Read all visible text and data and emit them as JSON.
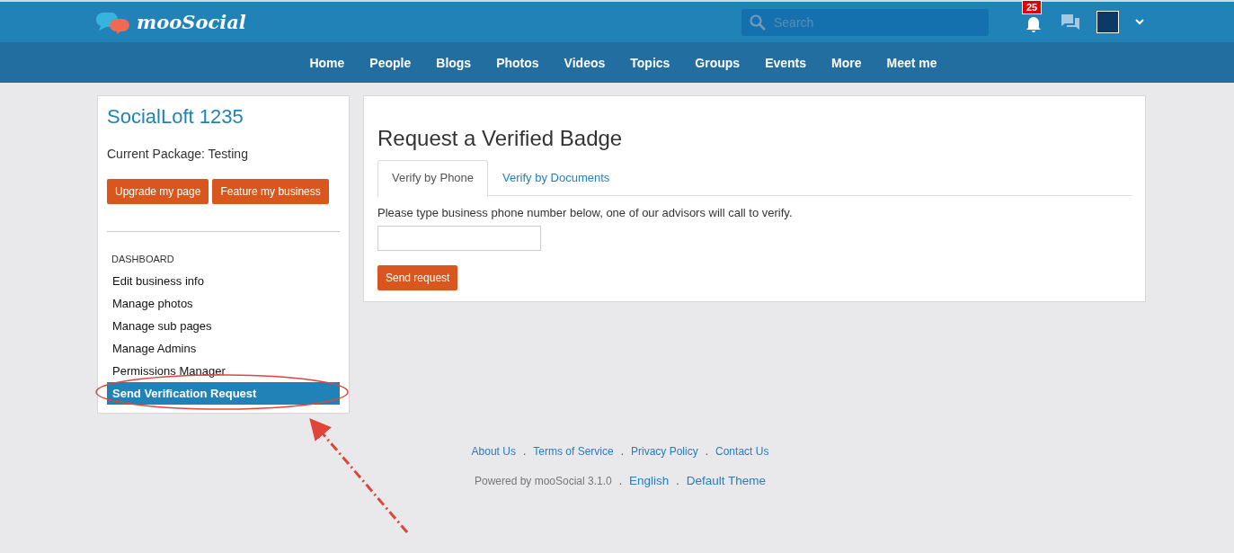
{
  "header": {
    "logo_text": "mooSocial",
    "search": {
      "placeholder": "Search"
    },
    "notification_count": "25"
  },
  "nav": [
    {
      "label": "Home"
    },
    {
      "label": "People"
    },
    {
      "label": "Blogs"
    },
    {
      "label": "Photos"
    },
    {
      "label": "Videos"
    },
    {
      "label": "Topics"
    },
    {
      "label": "Groups"
    },
    {
      "label": "Events"
    },
    {
      "label": "More"
    },
    {
      "label": "Meet me"
    }
  ],
  "sidebar": {
    "title": "SocialLoft 1235",
    "package": "Current Package: Testing",
    "buttons": [
      "Upgrade my page",
      "Feature my business"
    ],
    "section": "DASHBOARD",
    "items": [
      {
        "label": "Edit business info",
        "selected": false
      },
      {
        "label": "Manage photos",
        "selected": false
      },
      {
        "label": "Manage sub pages",
        "selected": false
      },
      {
        "label": "Manage Admins",
        "selected": false
      },
      {
        "label": "Permissions Manager",
        "selected": false
      },
      {
        "label": "Send Verification Request",
        "selected": true
      }
    ]
  },
  "main": {
    "title": "Request a Verified Badge",
    "tabs": [
      {
        "label": "Verify by Phone",
        "selected": true
      },
      {
        "label": "Verify by Documents",
        "selected": false
      }
    ],
    "instruction": "Please type business phone number below, one of our advisors will call to verify.",
    "submit": "Send request"
  },
  "footer": {
    "links": [
      {
        "label": "About Us"
      },
      {
        "separator": ".",
        "label": "Terms of Service"
      },
      {
        "separator": ".",
        "label": "Privacy Policy"
      },
      {
        "separator": ".",
        "label": "Contact Us"
      }
    ],
    "powered": "Powered by mooSocial 3.1.0",
    "extras": [
      {
        "separator": ".",
        "label": "English"
      },
      {
        "separator": ".",
        "label": "Default Theme"
      }
    ]
  }
}
